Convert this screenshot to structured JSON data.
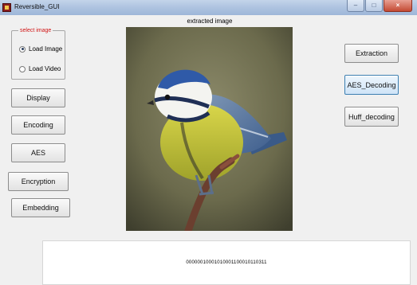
{
  "window": {
    "title": "Reversible_GUI",
    "controls": {
      "minimize": "–",
      "maximize": "□",
      "close": "×"
    }
  },
  "image_panel": {
    "caption": "extracted image",
    "icon": "bird-image"
  },
  "select_image": {
    "legend": "select image",
    "options": [
      {
        "label": "Load Image",
        "selected": true
      },
      {
        "label": "Load Video",
        "selected": false
      }
    ]
  },
  "left_buttons": [
    {
      "label": "Display"
    },
    {
      "label": "Encoding"
    },
    {
      "label": "AES"
    },
    {
      "label": "Encryption"
    },
    {
      "label": "Embedding"
    }
  ],
  "right_buttons": [
    {
      "label": "Extraction"
    },
    {
      "label": "AES_Decoding"
    },
    {
      "label": "Huff_decoding"
    }
  ],
  "output": {
    "text": "00000010001010001100010110311"
  },
  "colors": {
    "titlebar": "#aec3e0",
    "legend_text": "#d11414",
    "focused_button_border": "#3c7fb1"
  }
}
